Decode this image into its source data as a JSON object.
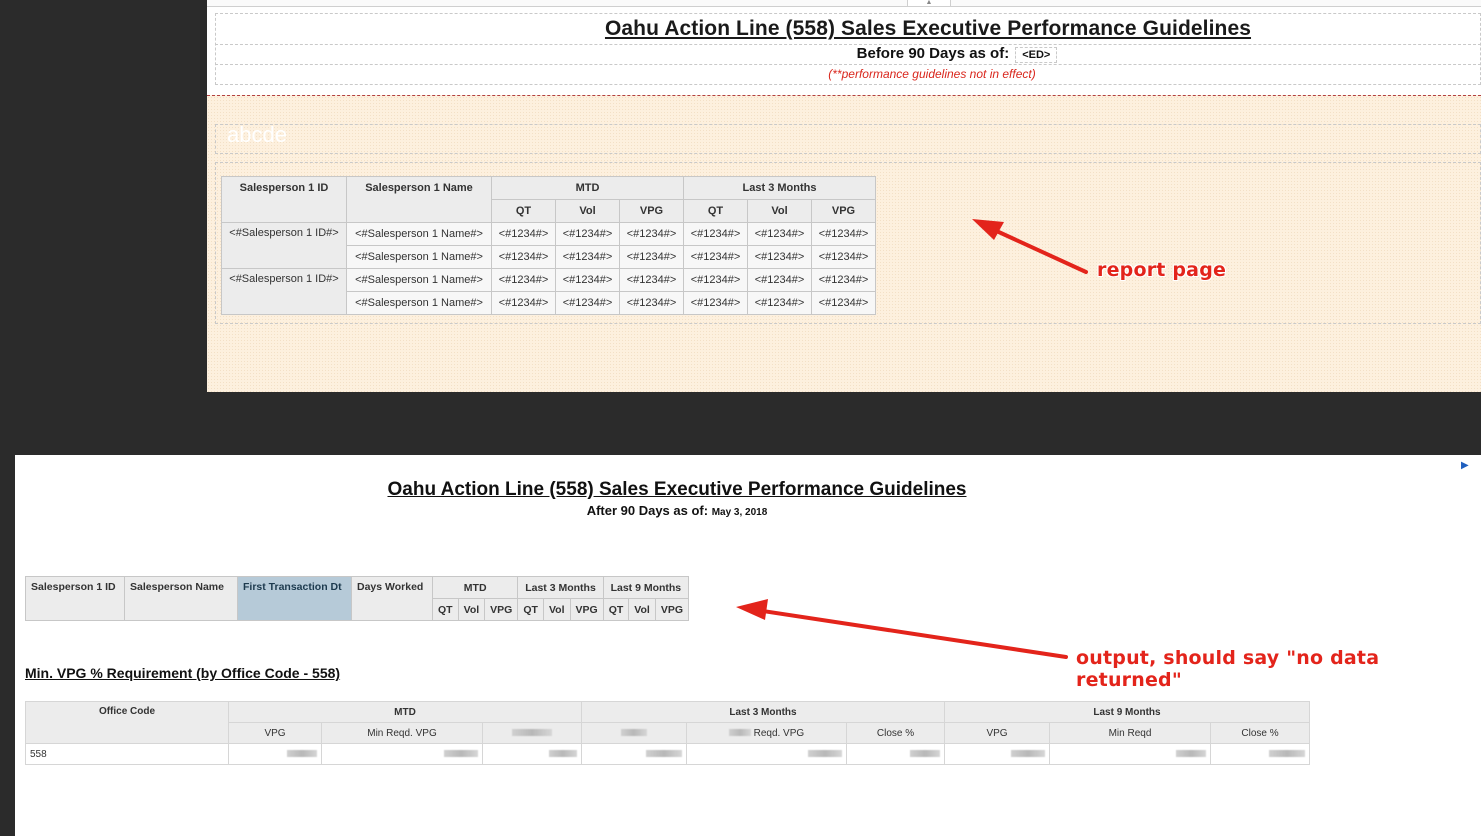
{
  "designer": {
    "title": "Oahu Action Line (558) Sales Executive Performance Guidelines",
    "subtitle_prefix": "Before 90 Days as of:",
    "subtitle_token": "<ED>",
    "note": "(**performance guidelines not in effect)",
    "placeholder_text": "abcde",
    "table": {
      "headers": {
        "id": "Salesperson 1 ID",
        "name": "Salesperson 1 Name",
        "mtd": "MTD",
        "last3": "Last 3 Months",
        "cols": [
          "QT",
          "Vol",
          "VPG",
          "QT",
          "Vol",
          "VPG"
        ]
      },
      "rows": [
        {
          "id": "<#Salesperson 1 ID#>",
          "name": "<#Salesperson 1 Name#>",
          "vals": [
            "<#1234#>",
            "<#1234#>",
            "<#1234#>",
            "<#1234#>",
            "<#1234#>",
            "<#1234#>"
          ]
        },
        {
          "id": "",
          "name": "<#Salesperson 1 Name#>",
          "vals": [
            "<#1234#>",
            "<#1234#>",
            "<#1234#>",
            "<#1234#>",
            "<#1234#>",
            "<#1234#>"
          ]
        },
        {
          "id": "<#Salesperson 1 ID#>",
          "name": "<#Salesperson 1 Name#>",
          "vals": [
            "<#1234#>",
            "<#1234#>",
            "<#1234#>",
            "<#1234#>",
            "<#1234#>",
            "<#1234#>"
          ]
        },
        {
          "id": "",
          "name": "<#Salesperson 1 Name#>",
          "vals": [
            "<#1234#>",
            "<#1234#>",
            "<#1234#>",
            "<#1234#>",
            "<#1234#>",
            "<#1234#>"
          ]
        }
      ]
    }
  },
  "output": {
    "title": "Oahu Action Line (558) Sales Executive Performance Guidelines",
    "subtitle_prefix": "After 90 Days as of:",
    "subtitle_date": "May 3, 2018",
    "table": {
      "headers": {
        "id": "Salesperson 1 ID",
        "name": "Salesperson Name",
        "first": "First Transaction Dt",
        "days": "Days Worked",
        "mtd": "MTD",
        "last3": "Last 3 Months",
        "last9": "Last 9 Months",
        "cols": [
          "QT",
          "Vol",
          "VPG",
          "QT",
          "Vol",
          "VPG",
          "QT",
          "Vol",
          "VPG"
        ]
      }
    },
    "section_title": "Min. VPG % Requirement (by Office Code - 558)",
    "office_table": {
      "office_code_header": "Office Code",
      "mtd": "MTD",
      "last3": "Last 3 Months",
      "last9": "Last 9 Months",
      "mtd_cols": [
        "VPG",
        "Min Reqd. VPG"
      ],
      "last3_cols": [
        "Reqd. VPG",
        "Close %"
      ],
      "last9_cols": [
        "VPG",
        "Min Reqd",
        "Close %"
      ],
      "row_code": "558"
    }
  },
  "annotations": {
    "report": "report page",
    "output": "output, should say \"no data returned\""
  },
  "colors": {
    "annotation": "#e3241b",
    "canvas": "#fdf0de",
    "selected_header": "#b6cad8"
  }
}
